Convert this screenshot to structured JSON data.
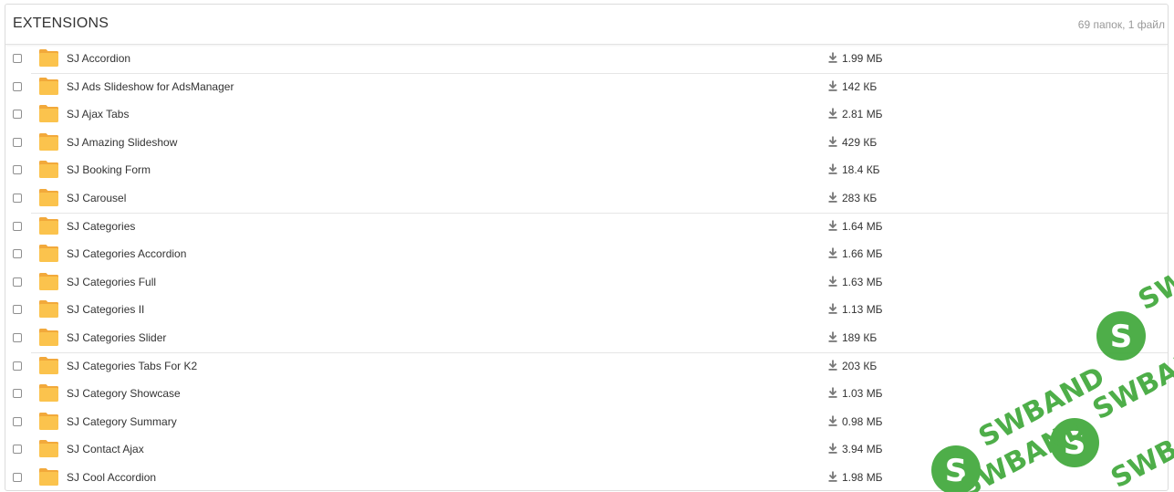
{
  "header": {
    "title": "EXTENSIONS",
    "summary": "69 папок, 1 файл"
  },
  "icons": {
    "row_icon": "folder-icon",
    "size_icon": "download-icon",
    "checkbox": "checkbox"
  },
  "colors": {
    "folder": "#FBC34D",
    "folder_tab": "#F2A93B",
    "watermark": "#3FA83A"
  },
  "watermark": {
    "text": "SWBAND"
  },
  "rows": [
    {
      "name": "SJ Accordion",
      "size": "1.99 МБ",
      "sep": false
    },
    {
      "name": "SJ Ads Slideshow for AdsManager",
      "size": "142 КБ",
      "sep": true
    },
    {
      "name": "SJ Ajax Tabs",
      "size": "2.81 МБ",
      "sep": false
    },
    {
      "name": "SJ Amazing Slideshow",
      "size": "429 КБ",
      "sep": false
    },
    {
      "name": "SJ Booking Form",
      "size": "18.4 КБ",
      "sep": false
    },
    {
      "name": "SJ Carousel",
      "size": "283 КБ",
      "sep": false
    },
    {
      "name": "SJ Categories",
      "size": "1.64 МБ",
      "sep": true
    },
    {
      "name": "SJ Categories Accordion",
      "size": "1.66 МБ",
      "sep": false
    },
    {
      "name": "SJ Categories Full",
      "size": "1.63 МБ",
      "sep": false
    },
    {
      "name": "SJ Categories II",
      "size": "1.13 МБ",
      "sep": false
    },
    {
      "name": "SJ Categories Slider",
      "size": "189 КБ",
      "sep": false
    },
    {
      "name": "SJ Categories Tabs For K2",
      "size": "203 КБ",
      "sep": true
    },
    {
      "name": "SJ Category Showcase",
      "size": "1.03 МБ",
      "sep": false
    },
    {
      "name": "SJ Category Summary",
      "size": "0.98 МБ",
      "sep": false
    },
    {
      "name": "SJ Contact Ajax",
      "size": "3.94 МБ",
      "sep": false
    },
    {
      "name": "SJ Cool Accordion",
      "size": "1.98 МБ",
      "sep": false
    }
  ]
}
